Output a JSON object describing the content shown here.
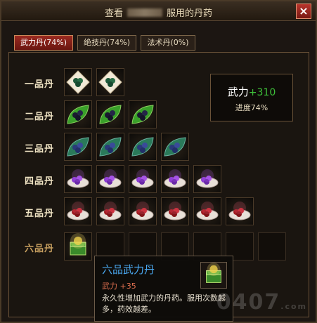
{
  "window": {
    "title_prefix": "查看",
    "title_suffix": "服用的丹药",
    "close_label": "×"
  },
  "tabs": [
    {
      "label": "武力丹(74%)",
      "active": true
    },
    {
      "label": "绝技丹(74%)",
      "active": false
    },
    {
      "label": "法术丹(0%)",
      "active": false
    }
  ],
  "rows": [
    {
      "label": "一品丹",
      "filled": 2,
      "total": 2,
      "style": "plate-white"
    },
    {
      "label": "二品丹",
      "filled": 3,
      "total": 3,
      "style": "leaf-green"
    },
    {
      "label": "三品丹",
      "filled": 4,
      "total": 4,
      "style": "leaf-blue"
    },
    {
      "label": "四品丹",
      "filled": 5,
      "total": 5,
      "style": "bowl-purple"
    },
    {
      "label": "五品丹",
      "filled": 6,
      "total": 6,
      "style": "bowl-red"
    },
    {
      "label": "六品丹",
      "filled": 1,
      "total": 7,
      "style": "chest-green"
    }
  ],
  "stat": {
    "name": "武力",
    "value": "+310",
    "progress": "进度74%"
  },
  "tooltip": {
    "name": "六品武力丹",
    "attr_name": "武力",
    "attr_value": "+35",
    "description": "永久性增加武力的丹药。服用次数越多，药效越差。"
  },
  "watermark": {
    "text": "0407",
    "suffix": ".com"
  },
  "colors": {
    "accent_active_tab": "#9a2a20",
    "stat_value": "#3ec13a",
    "tooltip_name": "#4aa8f0",
    "tooltip_attr": "#e07050"
  }
}
